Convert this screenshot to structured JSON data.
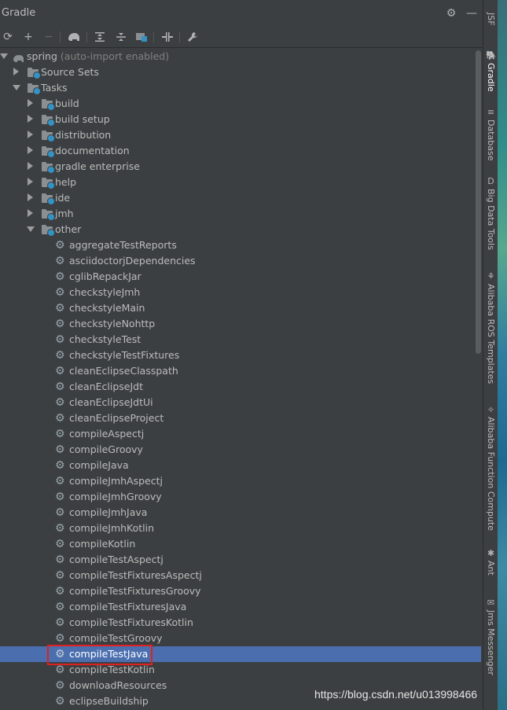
{
  "panel": {
    "title": "Gradle"
  },
  "tree": {
    "root": {
      "label": "spring",
      "hint": "(auto-import enabled)"
    },
    "source_sets": "Source Sets",
    "tasks": "Tasks",
    "groups": [
      "build",
      "build setup",
      "distribution",
      "documentation",
      "gradle enterprise",
      "help",
      "ide",
      "jmh",
      "other"
    ],
    "tasks_other": [
      "aggregateTestReports",
      "asciidoctorjDependencies",
      "cglibRepackJar",
      "checkstyleJmh",
      "checkstyleMain",
      "checkstyleNohttp",
      "checkstyleTest",
      "checkstyleTestFixtures",
      "cleanEclipseClasspath",
      "cleanEclipseJdt",
      "cleanEclipseJdtUi",
      "cleanEclipseProject",
      "compileAspectj",
      "compileGroovy",
      "compileJava",
      "compileJmhAspectj",
      "compileJmhGroovy",
      "compileJmhJava",
      "compileJmhKotlin",
      "compileKotlin",
      "compileTestAspectj",
      "compileTestFixturesAspectj",
      "compileTestFixturesGroovy",
      "compileTestFixturesJava",
      "compileTestFixturesKotlin",
      "compileTestGroovy",
      "compileTestJava",
      "compileTestKotlin",
      "downloadResources",
      "eclipseBuildship"
    ],
    "selected": "compileTestJava"
  },
  "side_tabs": [
    {
      "label": "JSF",
      "icon": "jsf-icon"
    },
    {
      "label": "Gradle",
      "icon": "elephant-icon"
    },
    {
      "label": "Database",
      "icon": "database-icon"
    },
    {
      "label": "Big Data Tools",
      "icon": "bigdata-icon"
    },
    {
      "label": "Alibaba ROS Templates",
      "icon": "ros-icon"
    },
    {
      "label": "Alibaba Function Compute",
      "icon": "function-icon"
    },
    {
      "label": "Ant",
      "icon": "ant-icon"
    },
    {
      "label": "Jms Messenger",
      "icon": "messenger-icon"
    }
  ],
  "watermark": "https://blog.csdn.net/u013998466",
  "colors": {
    "background": "#3c3f41",
    "selection": "#4b6eaf",
    "highlight": "#e02020"
  }
}
